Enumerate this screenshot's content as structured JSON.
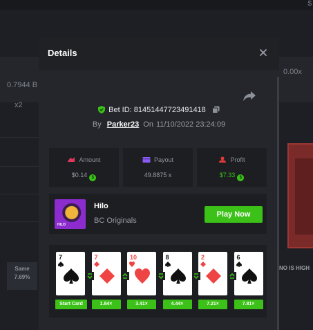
{
  "background": {
    "top_right_symbol": "$",
    "left_value": "0.7944 B",
    "left_multiplier": "x2",
    "right_value": "0.00x",
    "same_label": "Same",
    "same_percent": "7.69%",
    "hint_text": "NO IS HIGH"
  },
  "modal": {
    "title": "Details",
    "bet_id_label": "Bet ID:",
    "bet_id": "81451447723491418",
    "by_label": "By",
    "username": "Parker23",
    "on_label": "On",
    "datetime": "11/10/2022 23:24:09",
    "stats": [
      {
        "label": "Amount",
        "value": "$0.14",
        "icon": "amount-icon",
        "coin": true,
        "positive": false
      },
      {
        "label": "Payout",
        "value": "49.8875 x",
        "icon": "payout-icon",
        "coin": false,
        "positive": false
      },
      {
        "label": "Profit",
        "value": "$7.33",
        "icon": "profit-icon",
        "coin": true,
        "positive": true
      }
    ],
    "game": {
      "thumb_text": "HILO",
      "name": "Hilo",
      "provider": "BC Originals",
      "play_label": "Play Now"
    },
    "cards": [
      {
        "rank": "7",
        "suit": "spade",
        "multiplier": "Start Card",
        "guess": null
      },
      {
        "rank": "7",
        "suit": "diamond",
        "multiplier": "1.84×",
        "guess": "lower"
      },
      {
        "rank": "10",
        "suit": "heart",
        "multiplier": "3.41×",
        "guess": "higher"
      },
      {
        "rank": "8",
        "suit": "spade",
        "multiplier": "4.44×",
        "guess": "lower"
      },
      {
        "rank": "2",
        "suit": "diamond",
        "multiplier": "7.21×",
        "guess": "lower"
      },
      {
        "rank": "6",
        "suit": "spade",
        "multiplier": "7.81×",
        "guess": "higher"
      }
    ]
  },
  "colors": {
    "accent_green": "#3bc117",
    "card_red": "#ef4444",
    "modal_bg": "#24262b",
    "panel_bg": "#1c1e22"
  }
}
